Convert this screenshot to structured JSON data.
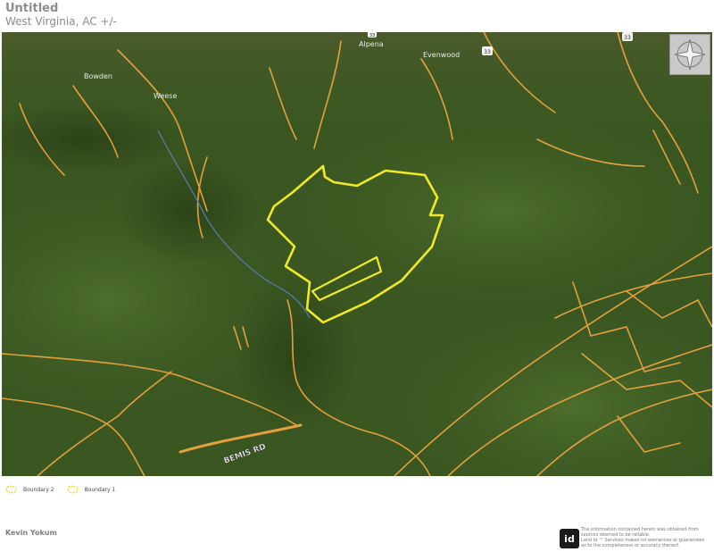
{
  "header": {
    "title": "Untitled",
    "subtitle": "West Virginia,  AC +/-"
  },
  "map": {
    "place_labels": [
      "Bowden",
      "Weese",
      "Alpena",
      "Evenwood"
    ],
    "road_labels": [
      "BEMIS RD"
    ],
    "route_shields": [
      "33",
      "33",
      "33"
    ],
    "colors": {
      "terrain": "#3b5a22",
      "roads": "#e5a03c",
      "boundary": "#f1ea24"
    }
  },
  "legend": {
    "items": [
      {
        "label": "Boundary 2",
        "icon": "boundary-icon"
      },
      {
        "label": "Boundary 1",
        "icon": "boundary-icon"
      }
    ]
  },
  "footer": {
    "owner": "Kevin Yokum",
    "logo_text": "id",
    "disclaimer": [
      "The information contained herein was obtained from",
      "sources deemed to be reliable.",
      "Land id ™ Services makes no warranties or guarantees",
      "as to the completeness or accuracy thereof."
    ]
  }
}
